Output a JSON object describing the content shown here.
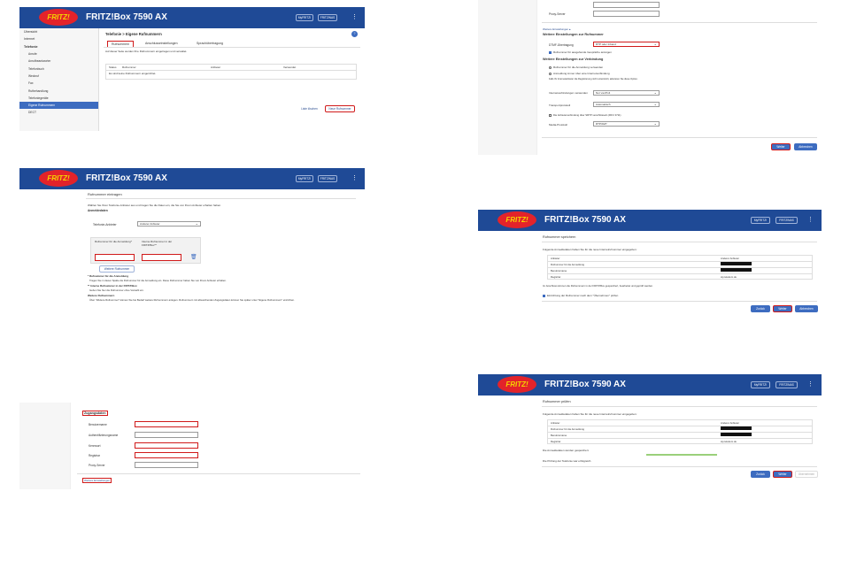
{
  "common": {
    "brand": "FRITZ!Box 7590 AX",
    "logo_text": "FRITZ!",
    "header_btn_1": "MyFRITZ!",
    "header_btn_2": "FRITZ!NAS",
    "menu_icon": "⋮"
  },
  "s1": {
    "sidebar": [
      "Übersicht",
      "Internet",
      "Telefonie",
      "Anrufe",
      "Anrufbeantworter",
      "Telefonbuch",
      "Weckruf",
      "Fax",
      "Rufbehandlung",
      "Telefoniegeräte",
      "Eigene Rufnummern",
      "DECT"
    ],
    "breadcrumb": "Telefonie > Eigene Rufnummern",
    "tabs": [
      "Rufnummern",
      "Anschlusseinstellungen",
      "Sprachübertragung"
    ],
    "intro": "Auf dieser Seite werden Ihre Rufnummern eingetragen und verwaltet.",
    "columns": [
      "Status",
      "Rufnummer",
      "Anbieter",
      "Verwendet"
    ],
    "empty": "Es sind keine Rufnummern eingerichtet.",
    "btn_delete": "Liste löschen",
    "btn_new": "Neue Rufnummer",
    "help": "?"
  },
  "s2": {
    "title": "Rufnummer eintragen",
    "intro": "Wählen Sie Ihren Telefonie-Anbieter aus und tragen Sie die Daten ein, die Sie von Ihrem Anbieter erhalten haben.",
    "section": "Anmeldedaten",
    "provider_label": "Telefonie-Anbieter",
    "provider_value": "Anderer Anbieter",
    "col1": "Rufnummer für die Anmeldung*",
    "col2": "Interne Rufnummer in der FRITZ!Box**",
    "btn_more": "Weitere Rufnummer",
    "note1": "* Rufnummer für die Anmeldung",
    "note1_text": "Tragen Sie in dieser Spalte die Rufnummer für die Anmeldung ein. Diese Rufnummer haben Sie von Ihrem Anbieter erhalten.",
    "note2": "** Interne Rufnummer in der FRITZ!Box",
    "note2_text": "Geben Sie hier die Rufnummer ohne Vorwahl ein.",
    "note3": "Weitere Rufnummern",
    "note3_text": "Über \"Weitere Rufnummer\" können Sie bei Bedarf weitere Rufnummern anlegen. Rufnummern mit abweichenden Zugangsdaten können Sie später unter \"Eigene Rufnummern\" einrichten."
  },
  "s3": {
    "section": "Zugangsdaten",
    "labels": [
      "Benutzername",
      "Authentifizierungsname",
      "Kennwort",
      "Registrar",
      "Proxy-Server"
    ],
    "more": "Weitere Einstellungen"
  },
  "s4": {
    "proxy_label": "Proxy-Server",
    "more_link": "Weitere Einstellungen ▴",
    "section1": "Weitere Einstellungen zur Rufnummer",
    "dtmf_label": "DTMF-Übertragung",
    "dtmf_value": "RTP oder Inband",
    "check1": "Rufnummer für ausgehende Gespräche anzeigen",
    "section2": "Weitere Einstellungen zur Verbindung",
    "radio1": "Rufnummer für die Anmeldung verwenden",
    "radio2": "Anmeldung immer über eine Internetverbindung",
    "info": "Falls Ihr Internetanbieter die Registrierung nicht unterstützt, aktivieren Sie diese Option.",
    "reg_label": "Internetverbindungen verwenden",
    "reg_value": "Nur via IPv4",
    "port_label": "Transportprotokoll",
    "port_value": "Automatisch",
    "check2": "Die Anbieterverbindung über SRTP verschlüsseln (RFC 3711)",
    "sip_label": "Media-Protokoll",
    "sip_value": "RTP/AVP",
    "btn_next": "Weiter",
    "btn_cancel": "Abbrechen"
  },
  "s5": {
    "title": "Rufnummer speichern",
    "intro": "Folgende Anmeldedaten haben Sie für die neue Internetrufnummer eingegeben:",
    "rows": [
      [
        "Anbieter",
        "Anderer Anbieter"
      ],
      [
        "Rufnummer für die Anmeldung",
        ""
      ],
      [
        "Benutzername",
        ""
      ],
      [
        "Registrar",
        "sip.telekom.de"
      ]
    ],
    "text": "Im Anschluss können die Rufnummern in der FRITZ!Box gespeichert, bearbeitet und geprüft werden.",
    "check": "Einrichtung der Rufnummer nach dem \"Übernehmen\" prüfen",
    "btn_back": "Zurück",
    "btn_next": "Weiter",
    "btn_cancel": "Abbrechen"
  },
  "s6": {
    "title": "Rufnummer prüfen",
    "intro": "Folgende Anmeldedaten haben Sie für die neue Internetrufnummer eingegeben:",
    "rows": [
      [
        "Anbieter",
        "Anderer Anbieter"
      ],
      [
        "Rufnummer für die Anmeldung",
        ""
      ],
      [
        "Benutzername",
        ""
      ],
      [
        "Registrar",
        "sip.telekom.de"
      ]
    ],
    "saved": "Die Anmeldedaten wurden gespeichert.",
    "test": "Die Prüfung der Telefonie war erfolgreich.",
    "btn_back": "Zurück",
    "btn_next": "Weiter",
    "btn_cancel": "Übernehmen"
  }
}
